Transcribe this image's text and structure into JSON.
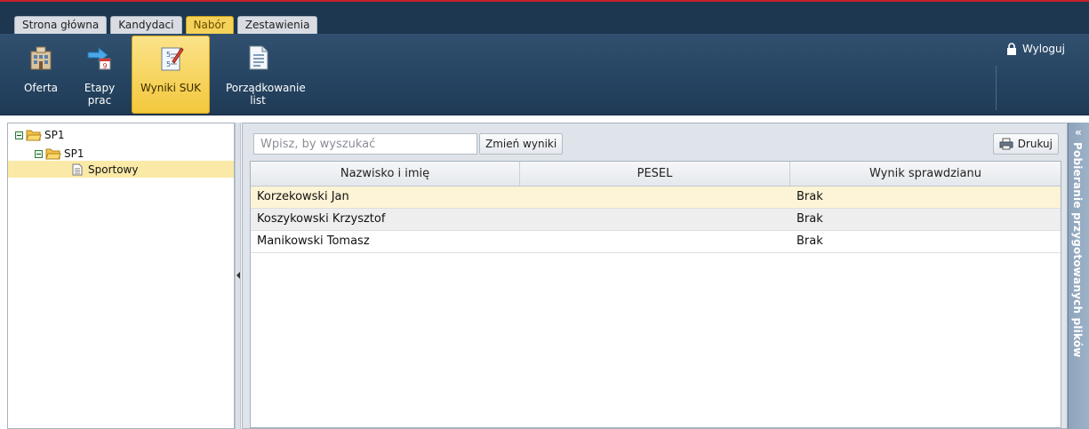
{
  "top_tabs": [
    {
      "label": "Strona główna",
      "active": false
    },
    {
      "label": "Kandydaci",
      "active": false
    },
    {
      "label": "Nabór",
      "active": true
    },
    {
      "label": "Zestawienia",
      "active": false
    }
  ],
  "ribbon": {
    "buttons": [
      {
        "label": "Oferta",
        "icon": "building-icon",
        "active": false
      },
      {
        "label": "Etapy prac",
        "icon": "calendar-arrow-icon",
        "active": false
      },
      {
        "label": "Wyniki SUK",
        "icon": "results-checklist-icon",
        "active": true
      },
      {
        "label": "Porządkowanie list",
        "icon": "document-list-icon",
        "active": false
      }
    ],
    "logout_label": "Wyloguj"
  },
  "tree": {
    "root": "SP1",
    "child": "SP1",
    "leaf": "Sportowy"
  },
  "toolbar": {
    "search_placeholder": "Wpisz, by wyszukać",
    "change_label": "Zmień wyniki",
    "print_label": "Drukuj"
  },
  "grid": {
    "columns": [
      "Nazwisko i imię",
      "PESEL",
      "Wynik sprawdzianu"
    ],
    "rows": [
      {
        "name": "Korzekowski Jan",
        "pesel": "",
        "result": "Brak"
      },
      {
        "name": "Koszykowski Krzysztof",
        "pesel": "",
        "result": "Brak"
      },
      {
        "name": "Manikowski Tomasz",
        "pesel": "",
        "result": "Brak"
      }
    ]
  },
  "right_panel": {
    "arrows": "«",
    "label": "Pobieranie przygotowanych plików"
  },
  "colors": {
    "header_bg": "#1e3751",
    "active_tab": "#f5d35a",
    "selected_row": "#fdf3d6",
    "side_panel": "#9db2c7"
  }
}
